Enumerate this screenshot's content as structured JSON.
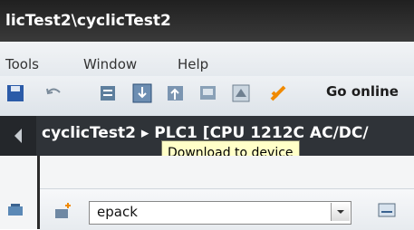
{
  "window": {
    "title": "licTest2\\cyclicTest2"
  },
  "menu": {
    "items": [
      {
        "label": "Tools"
      },
      {
        "label": "Window"
      },
      {
        "label": "Help"
      }
    ]
  },
  "toolbar": {
    "go_online_label": "Go online",
    "icons": [
      "save-icon",
      "undo-icon",
      "compile-icon",
      "download-to-device-icon",
      "upload-from-device-icon",
      "simulation-icon",
      "runtime-icon",
      "go-online-icon"
    ]
  },
  "nav": {
    "path": "cyclicTest2 ▸ PLC1 [CPU 1212C AC/DC/"
  },
  "tooltip": {
    "text": "Download to device"
  },
  "filter": {
    "value": "epack"
  }
}
